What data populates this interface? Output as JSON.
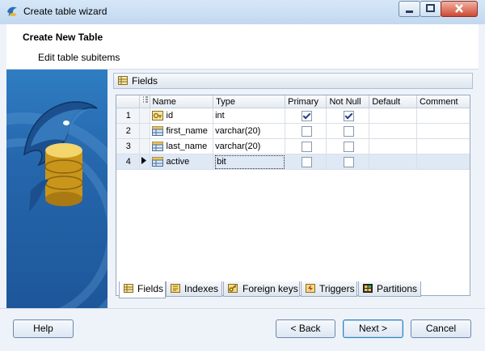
{
  "window": {
    "title": "Create table wizard"
  },
  "header": {
    "title": "Create New Table",
    "subtitle": "Edit table subitems"
  },
  "fields_panel": {
    "title": "Fields"
  },
  "grid": {
    "columns": [
      "Name",
      "Type",
      "Primary",
      "Not Null",
      "Default",
      "Comment"
    ],
    "rows": [
      {
        "num": "1",
        "name": "id",
        "type": "int",
        "primary": true,
        "not_null": true,
        "default": "",
        "comment": "",
        "icon": "key-field-icon"
      },
      {
        "num": "2",
        "name": "first_name",
        "type": "varchar(20)",
        "primary": false,
        "not_null": false,
        "default": "",
        "comment": "",
        "icon": "field-icon"
      },
      {
        "num": "3",
        "name": "last_name",
        "type": "varchar(20)",
        "primary": false,
        "not_null": false,
        "default": "",
        "comment": "",
        "icon": "field-icon"
      },
      {
        "num": "4",
        "name": "active",
        "type": "bit",
        "primary": false,
        "not_null": false,
        "default": "",
        "comment": "",
        "icon": "field-icon",
        "selected": true
      }
    ]
  },
  "tabs": [
    "Fields",
    "Indexes",
    "Foreign keys",
    "Triggers",
    "Partitions"
  ],
  "active_tab": "Fields",
  "buttons": {
    "help": "Help",
    "back": "< Back",
    "next": "Next >",
    "cancel": "Cancel"
  },
  "colors": {
    "accent": "#2f7dc2",
    "selection": "#dfe9f6",
    "close": "#cc4a31"
  }
}
